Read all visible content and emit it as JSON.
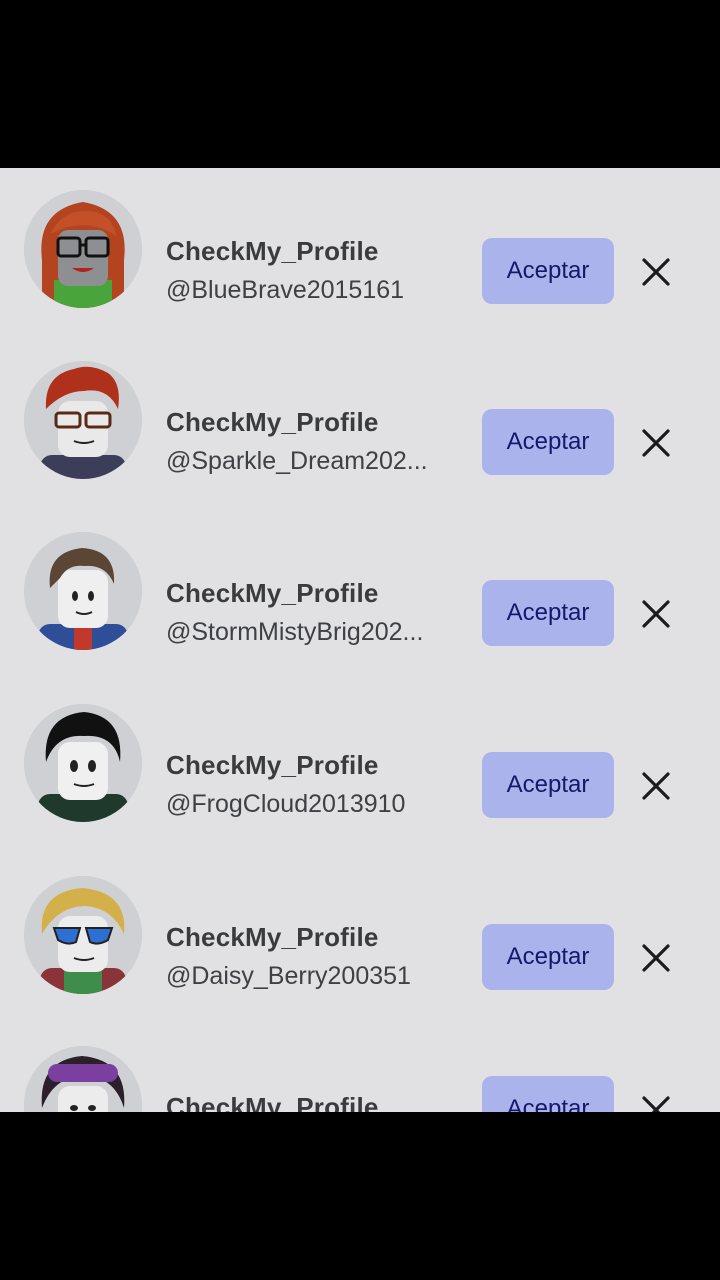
{
  "requests": [
    {
      "display_name": "CheckMy_Profile",
      "username": "@BlueBrave2015161",
      "accept_label": "Aceptar",
      "avatar": "red-hair-glasses"
    },
    {
      "display_name": "CheckMy_Profile",
      "username": "@Sparkle_Dream202...",
      "accept_label": "Aceptar",
      "avatar": "red-spiky-hair-glasses"
    },
    {
      "display_name": "CheckMy_Profile",
      "username": "@StormMistyBrig202...",
      "accept_label": "Aceptar",
      "avatar": "brown-hair-jacket"
    },
    {
      "display_name": "CheckMy_Profile",
      "username": "@FrogCloud2013910",
      "accept_label": "Aceptar",
      "avatar": "black-hair"
    },
    {
      "display_name": "CheckMy_Profile",
      "username": "@Daisy_Berry200351",
      "accept_label": "Aceptar",
      "avatar": "blonde-sunglasses"
    },
    {
      "display_name": "CheckMy_Profile",
      "username": "",
      "accept_label": "Aceptar",
      "avatar": "purple-hair-goggles"
    }
  ],
  "colors": {
    "background": "#e1e1e3",
    "accept_button": "#abb3ec",
    "accept_text": "#16186a"
  },
  "icons": {
    "dismiss": "close-icon"
  }
}
